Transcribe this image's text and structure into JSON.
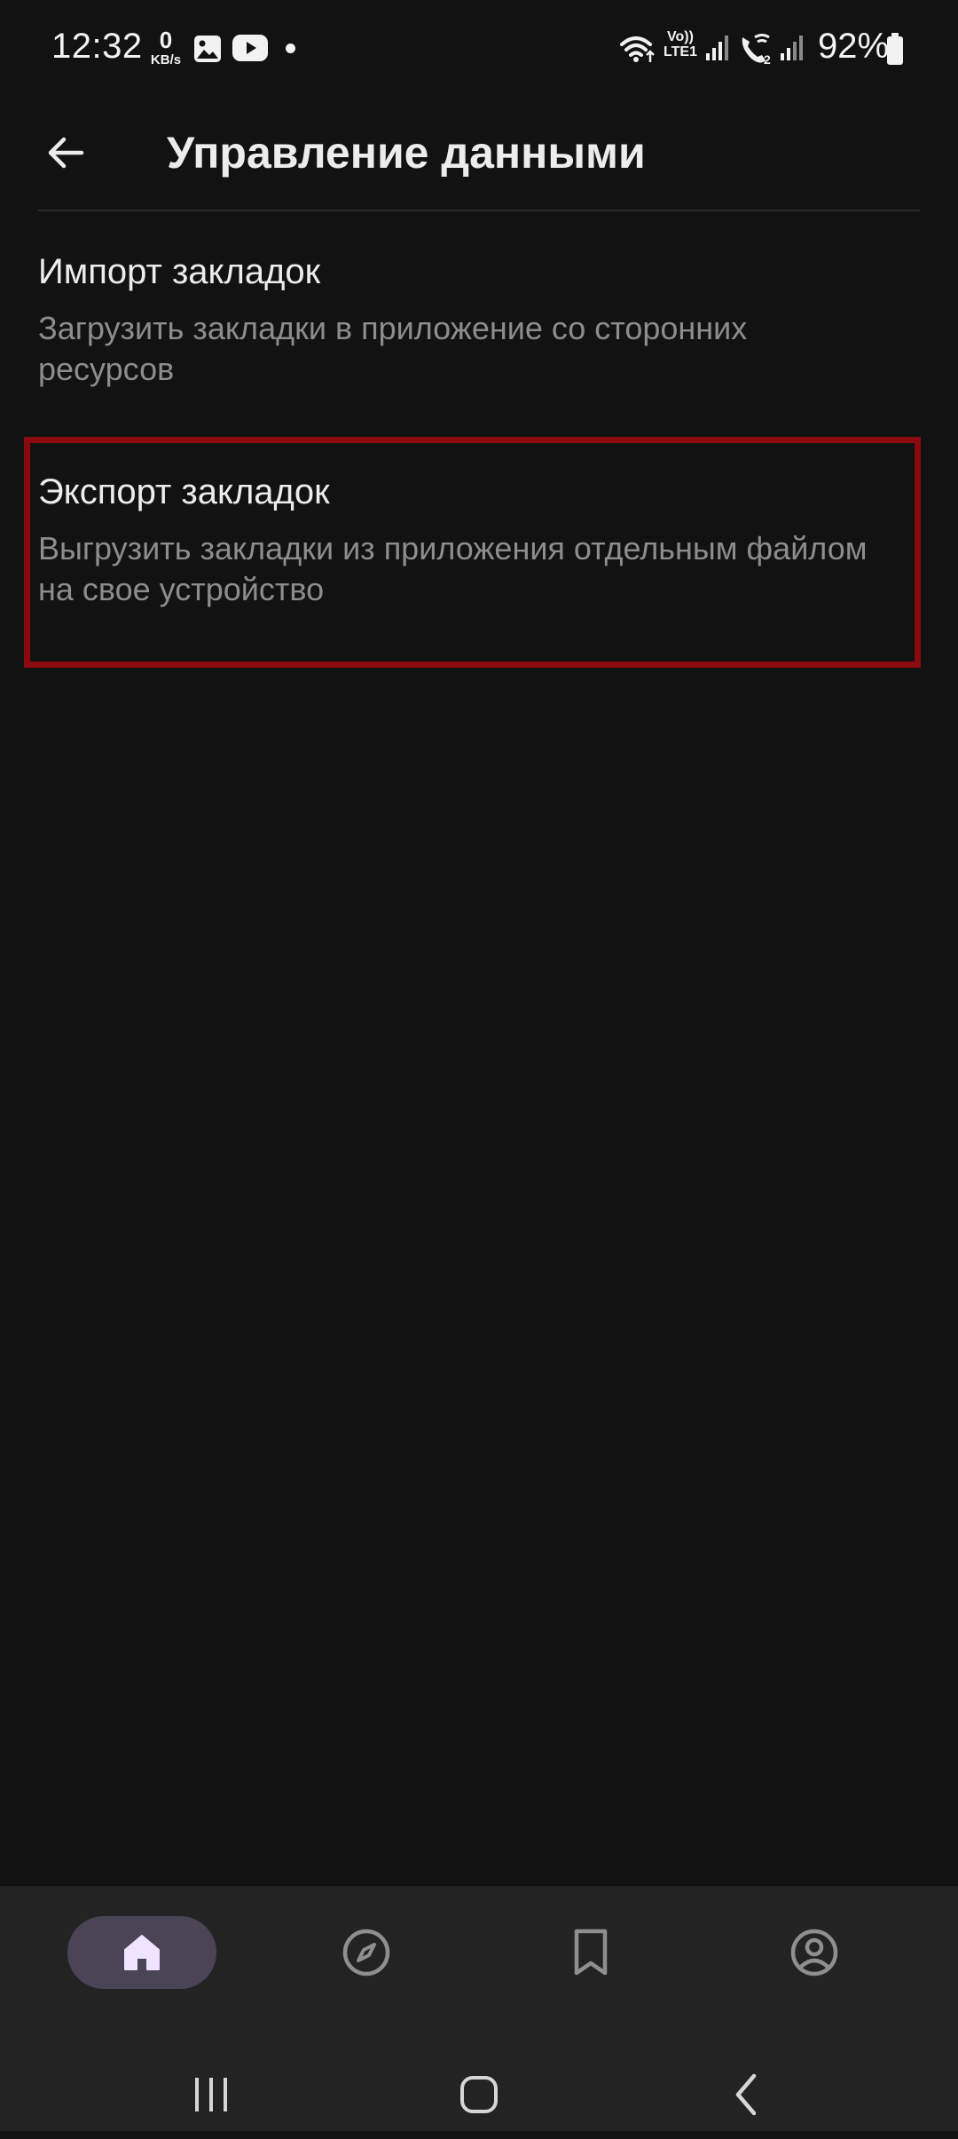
{
  "status_bar": {
    "time": "12:32",
    "net_speed_value": "0",
    "net_speed_unit": "KB/s",
    "volte_top": "Vo))",
    "volte_bottom": "LTE1",
    "sim2_label": "2",
    "battery": "92%"
  },
  "app_bar": {
    "title": "Управление данными"
  },
  "items": [
    {
      "title": "Импорт закладок",
      "subtitle": "Загрузить закладки в приложение со сторонних ресурсов"
    },
    {
      "title": "Экспорт закладок",
      "subtitle": "Выгрузить закладки из приложения отдельным файлом на свое устройство"
    }
  ],
  "bottom_nav": {
    "icons": [
      "home-icon",
      "compass-icon",
      "bookmark-icon",
      "profile-icon"
    ],
    "active_index": 0
  },
  "system_nav": {
    "icons": [
      "recents-icon",
      "home-circle-icon",
      "back-chevron-icon"
    ]
  },
  "colors": {
    "background": "#121212",
    "highlight_border": "#8b0a0f",
    "active_nav_pill": "#4a4457",
    "active_nav_icon": "#efe3ff",
    "subtitle_text": "#8d8d8d"
  }
}
